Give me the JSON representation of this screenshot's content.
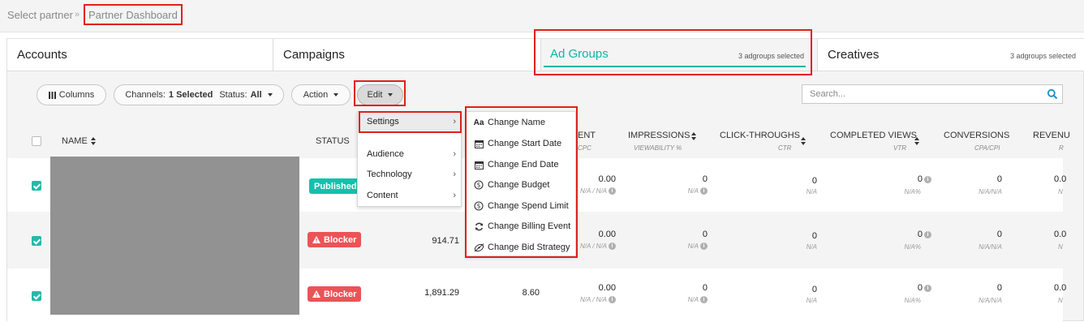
{
  "breadcrumb": {
    "parent": "Select partner",
    "separator": "»",
    "current": "Partner Dashboard"
  },
  "tabs": [
    {
      "label": "Accounts",
      "note": ""
    },
    {
      "label": "Campaigns",
      "note": ""
    },
    {
      "label": "Ad Groups",
      "note": "3 adgroups selected",
      "active": true
    },
    {
      "label": "Creatives",
      "note": "3 adgroups selected"
    }
  ],
  "toolbar": {
    "columns_label": "Columns",
    "channels_label": "Channels:",
    "channels_value": "1 Selected",
    "status_label": "Status:",
    "status_value": "All",
    "action_label": "Action",
    "edit_label": "Edit",
    "search_placeholder": "Search..."
  },
  "columns": {
    "name": "NAME",
    "status": "STATUS",
    "spend_partial": "ENT",
    "spend_sub": "CPC",
    "impressions": "IMPRESSIONS",
    "impressions_sub": "VIEWABILITY %",
    "clicks": "CLICK-THROUGHS",
    "clicks_sub": "CTR",
    "completed": "COMPLETED VIEWS",
    "completed_sub": "VTR",
    "conversions": "CONVERSIONS",
    "conversions_sub": "CPA/CPI",
    "revenue": "REVENU",
    "revenue_sub": "R"
  },
  "rows": [
    {
      "checked": true,
      "status": "Published",
      "status_type": "published",
      "budget": "",
      "col2": "",
      "spend": "0.00",
      "spend_sub": "N/A / N/A",
      "impressions": "0",
      "impressions_sub": "N/A",
      "clicks": "0",
      "clicks_sub": "N/A",
      "completed": "0",
      "completed_sub": "N/A%",
      "conversions": "0",
      "conversions_sub": "N/A/N/A",
      "revenue": "0.0",
      "revenue_sub": "N"
    },
    {
      "checked": true,
      "status": "Blocker",
      "status_type": "blocker",
      "budget": "914.71",
      "col2": "",
      "spend": "0.00",
      "spend_sub": "N/A / N/A",
      "impressions": "0",
      "impressions_sub": "N/A",
      "clicks": "0",
      "clicks_sub": "N/A",
      "completed": "0",
      "completed_sub": "N/A%",
      "conversions": "0",
      "conversions_sub": "N/A/N/A",
      "revenue": "0.0",
      "revenue_sub": "N"
    },
    {
      "checked": true,
      "status": "Blocker",
      "status_type": "blocker",
      "budget": "1,891.29",
      "col2": "8.60",
      "spend": "0.00",
      "spend_sub": "N/A / N/A",
      "impressions": "0",
      "impressions_sub": "N/A",
      "clicks": "0",
      "clicks_sub": "N/A",
      "completed": "0",
      "completed_sub": "N/A%",
      "conversions": "0",
      "conversions_sub": "N/A/N/A",
      "revenue": "0.0",
      "revenue_sub": "N"
    }
  ],
  "edit_menu": {
    "items": [
      {
        "label": "Settings",
        "icon": "chevron-right-icon"
      },
      {
        "label": "Audience",
        "icon": "chevron-right-icon"
      },
      {
        "label": "Technology",
        "icon": "chevron-right-icon"
      },
      {
        "label": "Content",
        "icon": "chevron-right-icon"
      }
    ],
    "chevron": "›"
  },
  "settings_menu": {
    "items": [
      {
        "label": "Change Name",
        "icon": "text-aa-icon",
        "glyph": "Aa"
      },
      {
        "label": "Change Start Date",
        "icon": "calendar-icon"
      },
      {
        "label": "Change End Date",
        "icon": "calendar-icon"
      },
      {
        "label": "Change Budget",
        "icon": "dollar-circle-icon"
      },
      {
        "label": "Change Spend Limit",
        "icon": "dollar-circle-icon"
      },
      {
        "label": "Change Billing Event",
        "icon": "refresh-icon"
      },
      {
        "label": "Change Bid Strategy",
        "icon": "bid-strategy-icon"
      }
    ]
  },
  "colors": {
    "accent": "#12b3a6",
    "published": "#13c1ab",
    "blocker": "#ea5457",
    "highlight": "#e0201b"
  }
}
